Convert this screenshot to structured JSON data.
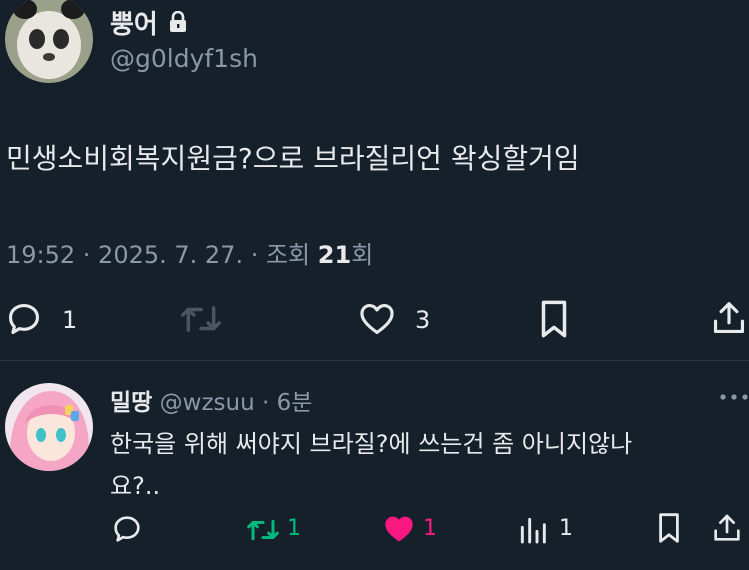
{
  "post": {
    "display_name": "뿡어",
    "handle": "@g0ldyf1sh",
    "text": "민생소비회복지원금?으로 브라질리언 왁싱할거임",
    "meta_time": "19:52 · 2025. 7. 27. · 조회",
    "meta_views": "21",
    "meta_views_suffix": "회",
    "counts": {
      "replies": "1",
      "likes": "3"
    }
  },
  "reply": {
    "display_name": "밀땅",
    "handle": "@wzsuu",
    "time": "· 6분",
    "text_line1": "한국을 위해 써야지 브라질?에 쓰는건 좀 아니지않나",
    "text_line2": "요?..",
    "counts": {
      "retweets": "1",
      "likes": "1",
      "views": "1"
    }
  },
  "colors": {
    "background": "#15202b",
    "text": "#e7e9ea",
    "muted": "#8b98a5",
    "retweet_active": "#00ba7c",
    "like_active": "#f91880"
  },
  "icons": [
    "lock-icon",
    "reply-icon",
    "retweet-icon",
    "like-icon",
    "bookmark-icon",
    "share-icon",
    "more-icon",
    "views-icon"
  ]
}
